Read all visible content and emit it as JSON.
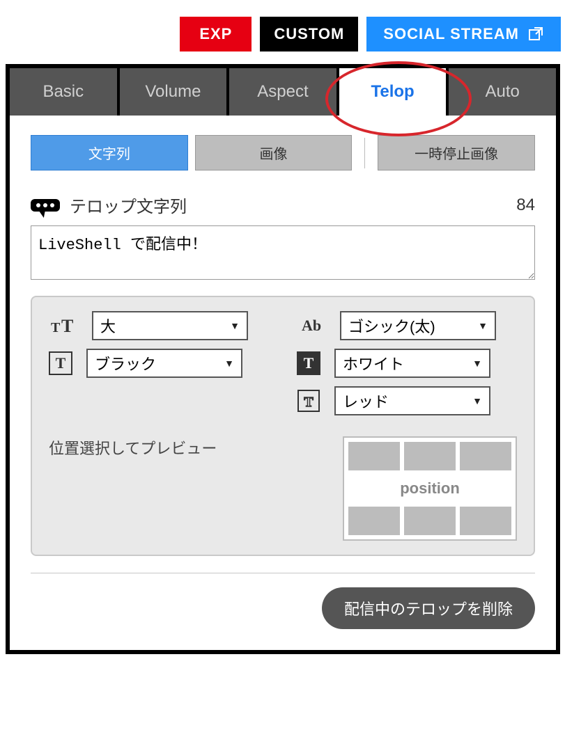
{
  "topbar": {
    "exp": "EXP",
    "custom": "CUSTOM",
    "social": "SOCIAL STREAM"
  },
  "tabs": {
    "basic": "Basic",
    "volume": "Volume",
    "aspect": "Aspect",
    "telop": "Telop",
    "auto": "Auto"
  },
  "subtabs": {
    "text": "文字列",
    "image": "画像",
    "pause_image": "一時停止画像"
  },
  "telop": {
    "section_title": "テロップ文字列",
    "char_count": "84",
    "text_value": "LiveShell で配信中！"
  },
  "settings": {
    "size": "大",
    "font": "ゴシック(太)",
    "color": "ブラック",
    "bg_color": "ホワイト",
    "outline_color": "レッド",
    "preview_label": "位置選択してプレビュー",
    "position_label": "position"
  },
  "actions": {
    "delete_telop": "配信中のテロップを削除"
  }
}
